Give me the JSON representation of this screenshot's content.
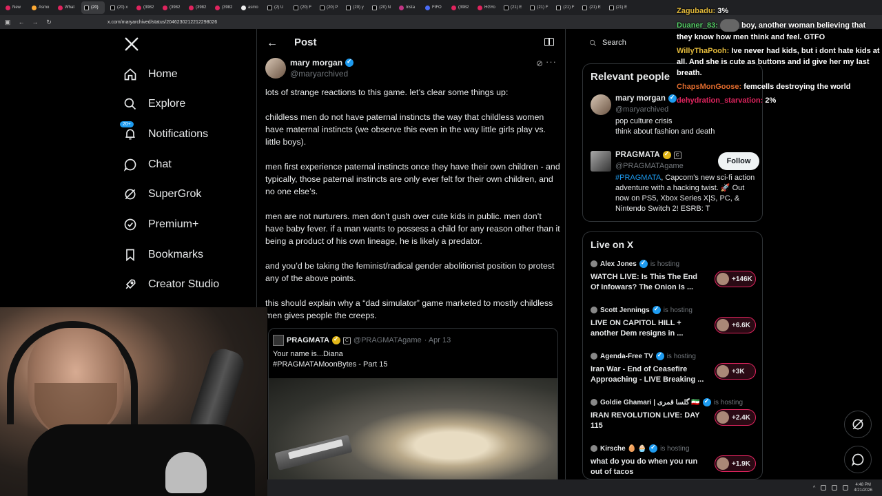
{
  "browser": {
    "tabs": [
      {
        "label": "New",
        "icon": "yt"
      },
      {
        "label": "Asmo",
        "icon": "o"
      },
      {
        "label": "What",
        "icon": "yt"
      },
      {
        "label": "(20)",
        "icon": "x",
        "active": true
      },
      {
        "label": "(20) x",
        "icon": "x"
      },
      {
        "label": "(3982",
        "icon": "yt"
      },
      {
        "label": "(3982",
        "icon": "yt"
      },
      {
        "label": "(3982",
        "icon": "yt"
      },
      {
        "label": "(3982",
        "icon": "yt"
      },
      {
        "label": "asmo",
        "icon": "g"
      },
      {
        "label": "(2) U",
        "icon": "x"
      },
      {
        "label": "(20) F",
        "icon": "x"
      },
      {
        "label": "(20) P",
        "icon": "x"
      },
      {
        "label": "(20) y",
        "icon": "x"
      },
      {
        "label": "(20) N",
        "icon": "x"
      },
      {
        "label": "Insta",
        "icon": "ig"
      },
      {
        "label": "FIFO",
        "icon": "b"
      },
      {
        "label": "(3982",
        "icon": "yt"
      },
      {
        "label": "HGYo",
        "icon": "yt"
      },
      {
        "label": "(21) E",
        "icon": "x"
      },
      {
        "label": "(21) F",
        "icon": "x"
      },
      {
        "label": "(21) F",
        "icon": "x"
      },
      {
        "label": "(21) E",
        "icon": "x"
      },
      {
        "label": "(21) E",
        "icon": "x"
      }
    ],
    "url": "x.com/maryarchived/status/2046230212212298026"
  },
  "nav": {
    "items": [
      {
        "label": "Home",
        "icon": "home-icon"
      },
      {
        "label": "Explore",
        "icon": "search-icon"
      },
      {
        "label": "Notifications",
        "icon": "bell-icon",
        "badge": "20+"
      },
      {
        "label": "Chat",
        "icon": "chat-icon"
      },
      {
        "label": "SuperGrok",
        "icon": "grok-icon"
      },
      {
        "label": "Premium+",
        "icon": "verified-icon"
      },
      {
        "label": "Bookmarks",
        "icon": "bookmark-icon"
      },
      {
        "label": "Creator Studio",
        "icon": "rocket-icon"
      }
    ]
  },
  "post": {
    "header_title": "Post",
    "author_name": "mary morgan",
    "author_handle": "@maryarchived",
    "paragraphs": [
      "lots of strange reactions to this game. let’s clear some things up:",
      "childless men do not have paternal instincts the way that childless women have maternal instincts (we observe this even in the way little girls play vs. little boys).",
      "men first experience paternal instincts once they have their own children - and typically, those paternal instincts are only ever felt for their own children, and no one else’s.",
      "men are not nurturers. men don’t gush over cute kids in public. men don’t have baby fever. if a man wants to possess a child for any reason other than it being a product of his own lineage, he is likely a predator.",
      "and you’d be taking the feminist/radical gender abolitionist position to protest any of the above points.",
      "this should explain why a “dad simulator” game marketed to mostly childless men gives people the creeps."
    ],
    "quote": {
      "name": "PRAGMATA",
      "badge": "C",
      "handle": "@PRAGMATAgame",
      "date": "· Apr 13",
      "line1": "Your name is...Diana",
      "line2": "#PRAGMATAMoonBytes - Part 15"
    }
  },
  "sidebar": {
    "search_placeholder": "Search",
    "relevant": {
      "title": "Relevant people",
      "people": [
        {
          "name": "mary morgan",
          "handle": "@maryarchived",
          "bio": "pop culture crisis",
          "bio2": "think about fashion and death"
        },
        {
          "name": "PRAGMATA",
          "badge": "C",
          "handle": "@PRAGMATAgame",
          "bio_tag": "#PRAGMATA",
          "bio": ", Capcom's new sci-fi action adventure with a hacking twist. 🚀 Out now on PS5, Xbox Series X|S, PC, & Nintendo Switch 2! ESRB: T",
          "follow_label": "Follow"
        }
      ]
    },
    "live": {
      "title": "Live on X",
      "hosting_label": "is hosting",
      "items": [
        {
          "host": "Alex Jones",
          "title": "WATCH LIVE: Is This The End Of Infowars? The Onion Is ...",
          "count": "+146K"
        },
        {
          "host": "Scott Jennings",
          "title": "LIVE ON CAPITOL HILL + another Dem resigns in ...",
          "count": "+6.6K"
        },
        {
          "host": "Agenda-Free TV",
          "title": "Iran War - End of Ceasefire Approaching - LIVE Breaking ...",
          "count": "+3K"
        },
        {
          "host": "Goldie Ghamari | گلسا قمری 🇮🇷",
          "title": "IRAN REVOLUTION LIVE: DAY 115",
          "count": "+2.4K"
        },
        {
          "host": "Kirsche 🥚 🧁",
          "title": "what do you do when you run out of tacos",
          "count": "+1.9K"
        }
      ]
    }
  },
  "chat": [
    {
      "user": "Zagubadu:",
      "msg": "3%"
    },
    {
      "user": "Duaner_83:",
      "msg": "boy, another woman believing that they know how men think and feel. GTFO",
      "emote": true
    },
    {
      "user": "WillyThaPooh:",
      "msg": "Ive never had kids, but i dont hate kids at all. And she is cute as buttons and id give her my last breath."
    },
    {
      "user": "ChapsMonGoose:",
      "msg": "femcells destroying the world"
    },
    {
      "user": "dehydration_starvation:",
      "msg": "2%"
    }
  ],
  "taskbar": {
    "time": "4:48 PM",
    "date": "4/21/2026"
  },
  "colors": {
    "accent": "#1d9bf0",
    "background": "#000000",
    "live_pill": "#e0245e"
  }
}
